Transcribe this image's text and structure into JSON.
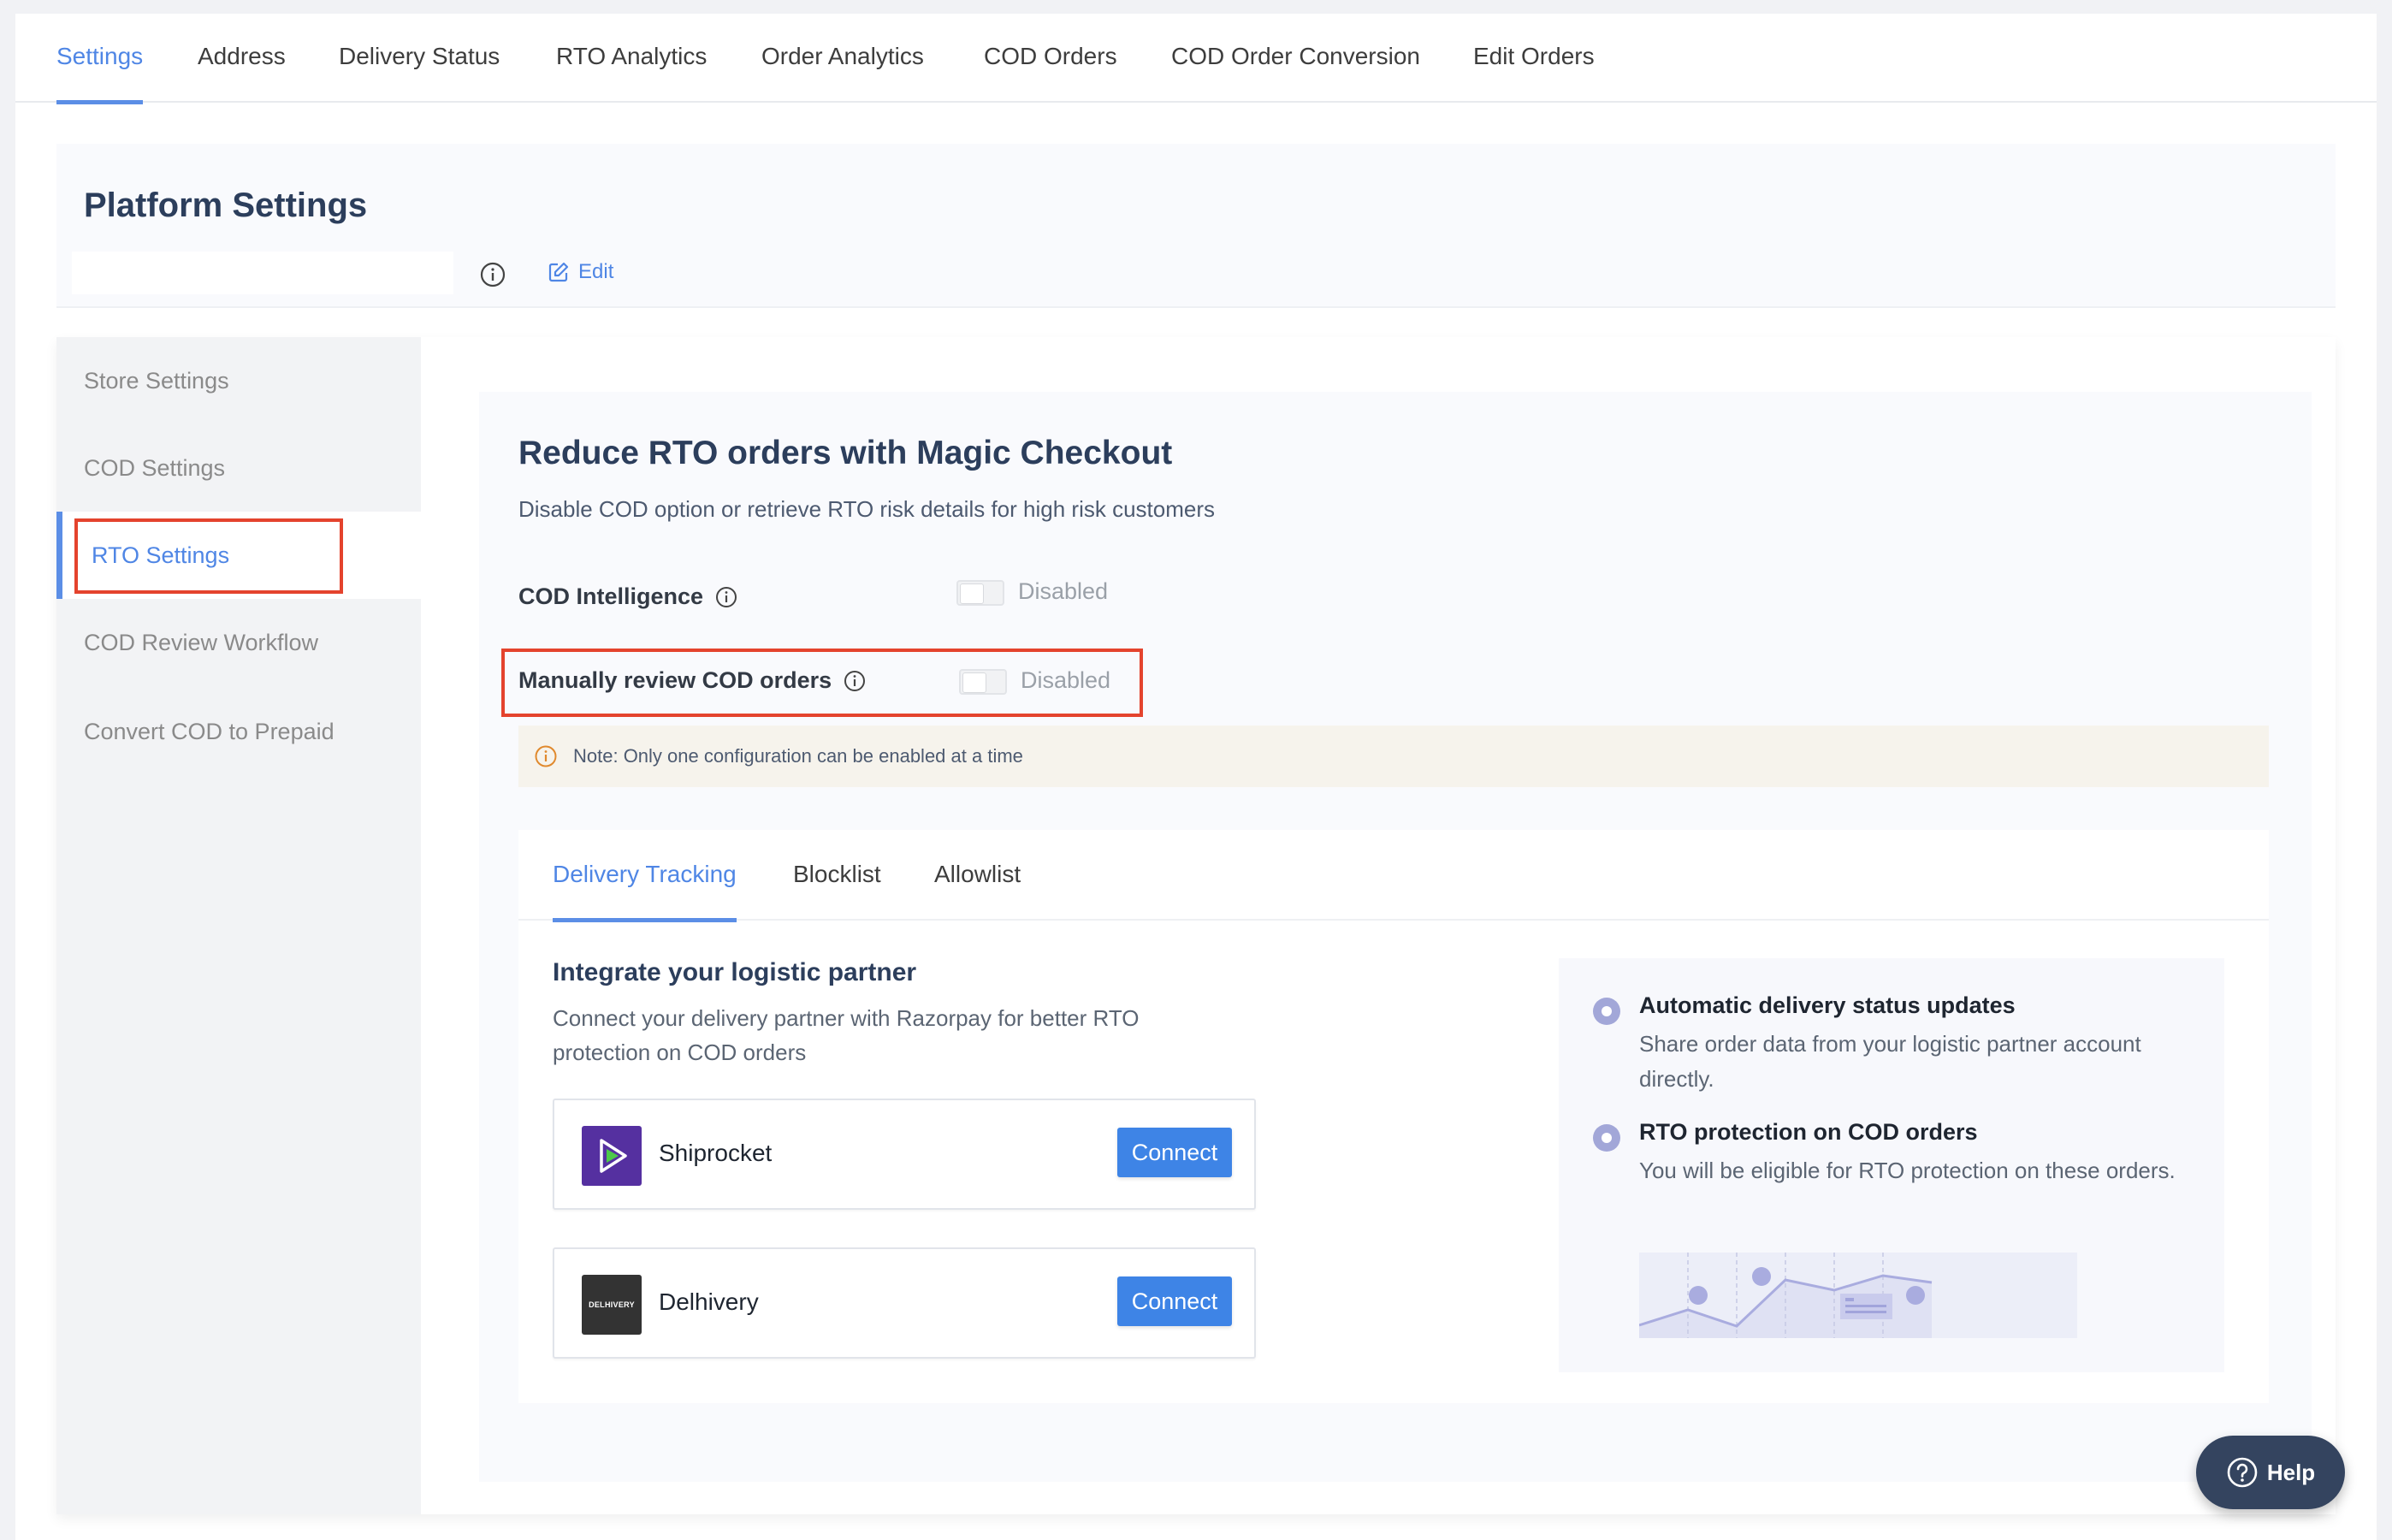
{
  "top_nav": {
    "tabs": [
      {
        "label": "Settings",
        "active": true
      },
      {
        "label": "Address",
        "active": false
      },
      {
        "label": "Delivery Status",
        "active": false
      },
      {
        "label": "RTO Analytics",
        "active": false
      },
      {
        "label": "Order Analytics",
        "active": false
      },
      {
        "label": "COD Orders",
        "active": false
      },
      {
        "label": "COD Order Conversion",
        "active": false
      },
      {
        "label": "Edit Orders",
        "active": false
      }
    ]
  },
  "platform": {
    "title": "Platform Settings",
    "field_value": "",
    "edit_label": "Edit"
  },
  "sidebar": {
    "items": [
      {
        "label": "Store Settings",
        "active": false
      },
      {
        "label": "COD Settings",
        "active": false
      },
      {
        "label": "RTO Settings",
        "active": true,
        "highlighted": true
      },
      {
        "label": "COD Review Workflow",
        "active": false
      },
      {
        "label": "Convert COD to Prepaid",
        "active": false
      }
    ]
  },
  "rto": {
    "heading": "Reduce RTO orders with Magic Checkout",
    "subheading": "Disable COD option or retrieve RTO risk details for high risk customers",
    "settings": [
      {
        "label": "COD Intelligence",
        "state": "Disabled",
        "enabled": false
      },
      {
        "label": "Manually review COD orders",
        "state": "Disabled",
        "enabled": false,
        "highlighted": true
      }
    ],
    "note": "Note: Only one configuration can be enabled at a time"
  },
  "tabs": {
    "items": [
      {
        "label": "Delivery Tracking",
        "active": true
      },
      {
        "label": "Blocklist",
        "active": false
      },
      {
        "label": "Allowlist",
        "active": false
      }
    ]
  },
  "delivery_tracking": {
    "title": "Integrate your logistic partner",
    "description": "Connect your delivery partner with Razorpay for better RTO protection on COD orders",
    "partners": [
      {
        "name": "Shiprocket",
        "button": "Connect",
        "logo_color": "#5530a0"
      },
      {
        "name": "Delhivery",
        "button": "Connect",
        "logo_color": "#333333",
        "logo_text": "DELHIVERY"
      }
    ],
    "benefits": [
      {
        "title": "Automatic delivery status updates",
        "description": "Share order data from your logistic partner account directly."
      },
      {
        "title": "RTO protection on COD orders",
        "description": "You will be eligible for RTO protection on these orders."
      }
    ]
  },
  "help": {
    "label": "Help"
  },
  "colors": {
    "accent": "#4f86e5",
    "button": "#3e84e6",
    "highlight_box": "#e4432d",
    "note_bg": "#f6f3ec",
    "help_bg": "#34445f"
  }
}
